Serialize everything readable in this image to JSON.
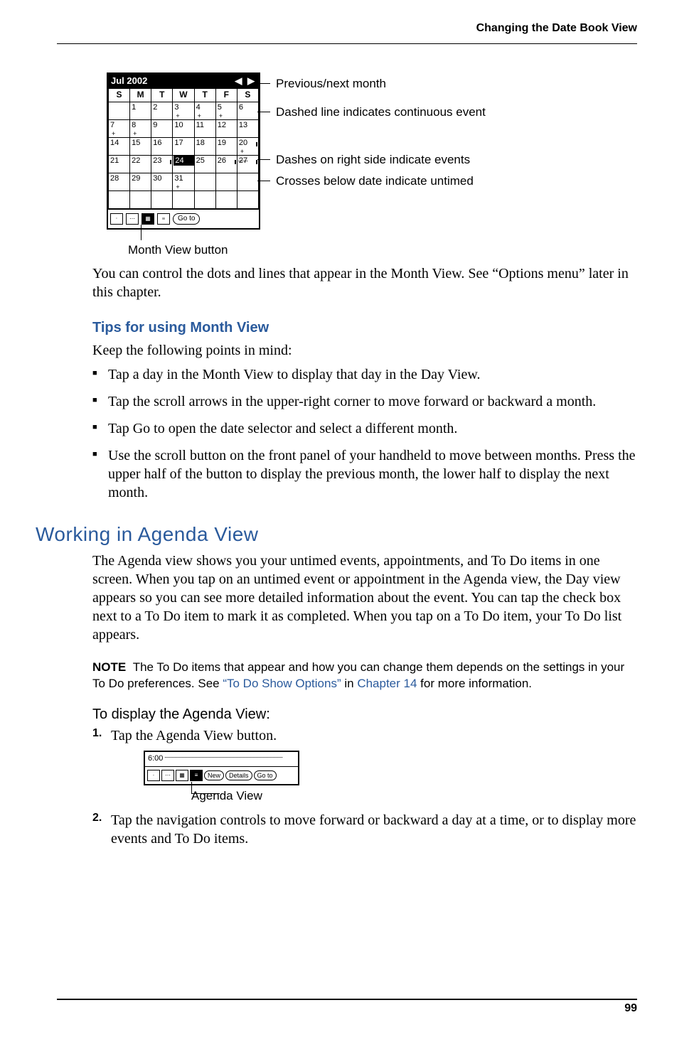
{
  "header": {
    "section_title": "Changing the Date Book View"
  },
  "figure_month": {
    "title": "Jul 2002",
    "day_headers": [
      "S",
      "M",
      "T",
      "W",
      "T",
      "F",
      "S"
    ],
    "weeks": [
      [
        "",
        "1",
        "2",
        "3",
        "4",
        "5",
        "6"
      ],
      [
        "7",
        "8",
        "9",
        "10",
        "11",
        "12",
        "13"
      ],
      [
        "14",
        "15",
        "16",
        "17",
        "18",
        "19",
        "20"
      ],
      [
        "21",
        "22",
        "23",
        "24",
        "25",
        "26",
        "27"
      ],
      [
        "28",
        "29",
        "30",
        "31",
        "",
        "",
        ""
      ]
    ],
    "today": "24",
    "goto_label": "Go to",
    "callouts": {
      "c1": "Previous/next month",
      "c2": "Dashed line indicates continuous event",
      "c3": "Dashes on right side indicate events",
      "c4": "Crosses below date indicate untimed"
    },
    "month_view_label": "Month View button"
  },
  "body": {
    "p_intro": "You can control the dots and lines that appear in the Month View. See “Options menu” later in this chapter.",
    "h3_tips": "Tips for using Month View",
    "p_keep": "Keep the following points in mind:",
    "bullets": [
      "Tap a day in the Month View to display that day in the Day View.",
      "Tap the scroll arrows in the upper-right corner to move forward or backward a month.",
      "Tap Go to open the date selector and select a different month.",
      "Use the scroll button on the front panel of your handheld to move between months. Press the upper half of the button to display the previous month, the lower half to display the next month."
    ],
    "h2_agenda": "Working in Agenda View",
    "p_agenda": "The Agenda view shows you your untimed events, appointments, and To Do items in one screen. When you tap on an untimed event or appointment in the Agenda view, the Day view appears so you can see more detailed information about the event. You can tap the check box next to a To Do item to mark it as completed. When you tap on a To Do item, your To Do list appears.",
    "note_label": "NOTE",
    "note_text1": "The To Do items that appear and how you can change them depends on the settings in your To Do preferences. See ",
    "note_link1": "“To Do Show Options”",
    "note_text2": " in ",
    "note_link2": "Chapter 14",
    "note_text3": " for more information.",
    "h4_display": "To display the Agenda View:",
    "step1": "Tap the Agenda View button.",
    "step2": "Tap the navigation controls to move forward or backward a day at a time, or to display more events and To Do items."
  },
  "figure_agenda": {
    "time": "6:00",
    "btn_new": "New",
    "btn_details": "Details",
    "btn_goto": "Go to",
    "label": "Agenda View"
  },
  "footer": {
    "page_number": "99"
  }
}
